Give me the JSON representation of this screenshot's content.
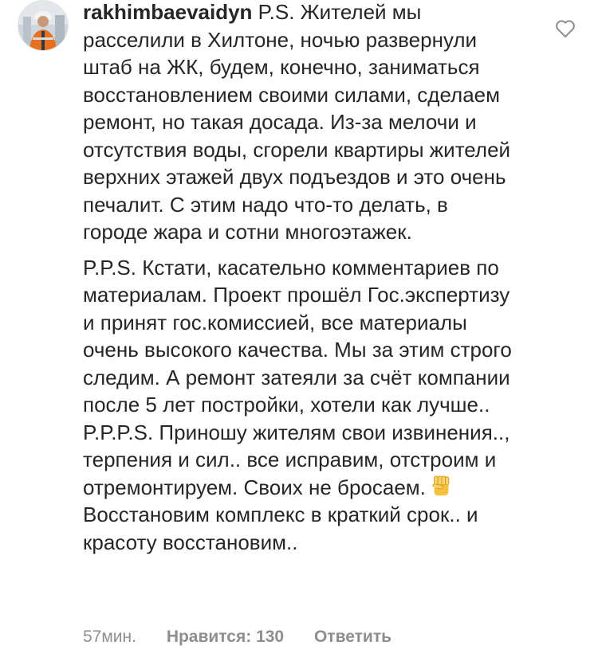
{
  "comment": {
    "username": "rakhimbaevaidyn",
    "paragraph_1": "P.S. Жителей мы расселили в Хилтоне, ночью развернули штаб на ЖК, будем, конечно, заниматься восстановлением своими силами, сделаем ремонт, но такая досада. Из-за мелочи и отсутствия воды, сгорели квартиры жителей верхних этажей двух подъездов и это очень печалит. С этим надо что-то делать, в городе жара и сотни многоэтажек.",
    "paragraph_2": "P.P.S. Кстати, касательно комментариев по материалам. Проект прошёл Гос.экспертизу и принят гос.комиссией, все материалы очень высокого качества. Мы за этим строго следим. А ремонт затеяли за счёт компании после 5 лет постройки, хотели как лучше.. P.P.P.S. Приношу жителям свои извинения.., терпения и сил.. все исправим, отстроим и отремонтируем. Своих не бросаем.",
    "paragraph_3": "Восстановим комплекс в краткий срок.. и красоту восстановим..",
    "time": "57мин.",
    "likes_label": "Нравится: 130",
    "reply_label": "Ответить"
  },
  "icons": {
    "like": "heart-outline-icon",
    "emoji": "raised-fist-emoji"
  },
  "colors": {
    "text": "#262626",
    "secondary": "#8e8e8e"
  }
}
